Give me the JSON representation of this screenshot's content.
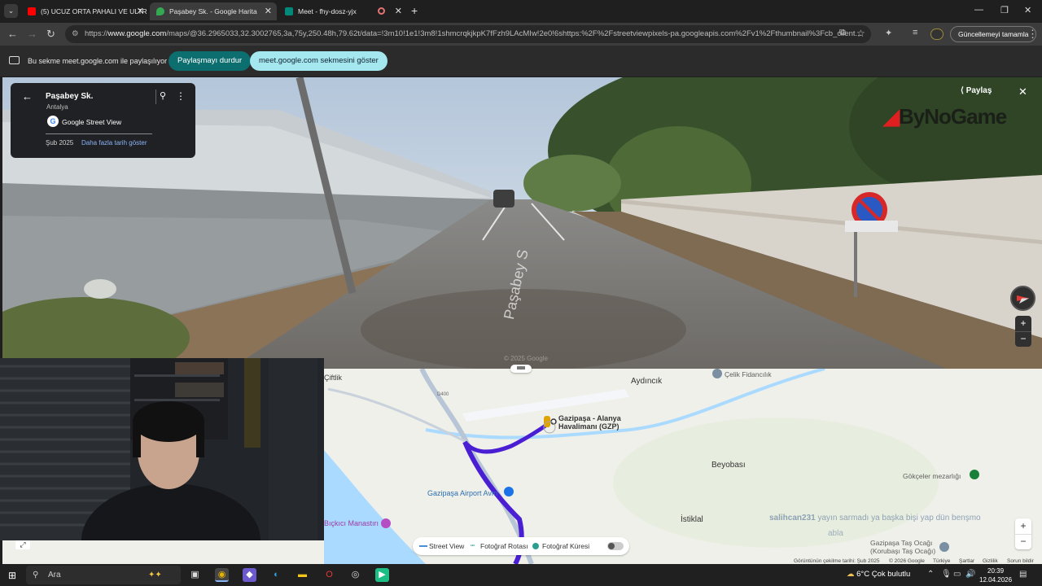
{
  "browser": {
    "tabs": [
      {
        "label": "(5) UCUZ ORTA PAHALI VE ULTR",
        "active": false
      },
      {
        "label": "Paşabey Sk. - Google Harita",
        "active": true
      },
      {
        "label": "Meet - fhy-dosz-yjx",
        "active": false
      }
    ],
    "url_prefix": "https://",
    "url_domain": "www.google.com",
    "url_rest": "/maps/@36.2965033,32.3002765,3a,75y,250.48h,79.62t/data=!3m10!1e1!3m8!1shmcrqkjkpK7fFzh9LAcMIw!2e0!6shttps:%2F%2Fstreetviewpixels-pa.googleapis.com%2Fv1%2Fthumbnail%3Fcb_client...",
    "update_button": "Güncellemeyi tamamla"
  },
  "sharebar": {
    "text": "Bu sekme meet.google.com ile paylaşılıyor",
    "stop_label": "Paylaşmayı durdur",
    "show_label": "meet.google.com sekmesini göster"
  },
  "streetview": {
    "place_title": "Paşabey Sk.",
    "place_sub": "Antalya",
    "source": "Google Street View",
    "date": "Şub 2025",
    "more_dates": "Daha fazla tarih göster",
    "share": "Paylaş",
    "road_text": "Paşabey S",
    "copyright": "© 2025 Google",
    "watermark": "ByNoGame"
  },
  "map": {
    "labels": {
      "aydincik": "Aydıncık",
      "airport": "Gazipaşa - Alanya Havalimanı (GZP)",
      "airport_line1": "Gazipaşa - Alanya",
      "airport_line2": "Havalimanı (GZP)",
      "fidanlik": "Çelik Fidancılık",
      "beyobasi": "Beyobası",
      "avm": "Gazipaşa Airport Avm",
      "gokceler": "Gökçeler mezarlığı",
      "istiklal": "İstiklal",
      "manastir": "Bıçkıcı Manastırı",
      "tasocagi_line1": "Gazipaşa Taş Ocağı",
      "tasocagi_line2": "(Korubaşı Taş Ocağı)",
      "road": "D400",
      "ciftlik": "Çiftlik"
    },
    "legend": {
      "streetview": "Street View",
      "photo_route": "Fotoğraf Rotası",
      "photo_sphere": "Fotoğraf Küresi"
    },
    "overlay_user": "salihcan231",
    "overlay_msg": "yayın sarmadı ya başka bişi yap dün benşmo",
    "overlay_msg2": "abla",
    "footer": {
      "imagery": "Görüntünün çekilme tarihi: Şub 2025",
      "copyright": "© 2026 Google",
      "country": "Türkiye",
      "terms": "Şartlar",
      "privacy": "Gizlilik",
      "report": "Sorun bildir"
    }
  },
  "taskbar": {
    "search_placeholder": "Ara",
    "temperature": "6°C",
    "weather": "Çok bulutlu",
    "time": "20:39",
    "date": "12.04.2026"
  },
  "colors": {
    "route": "#4a1fd4",
    "share_stop": "#0d6e70",
    "share_show": "#a5e7ee",
    "link_blue": "#8ab4f8"
  }
}
